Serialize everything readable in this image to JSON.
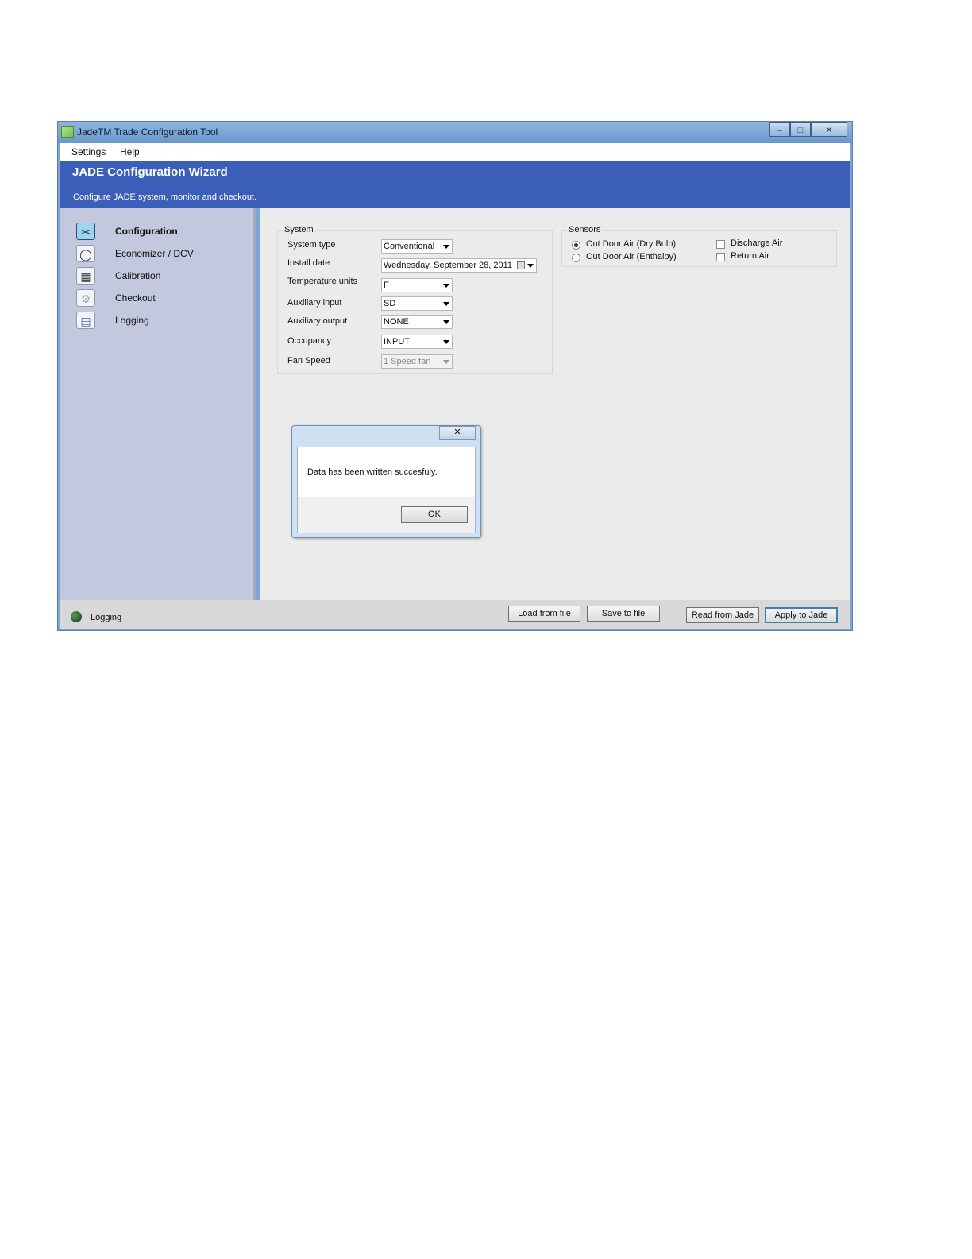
{
  "window": {
    "title": "JadeTM Trade Configuration Tool",
    "controls": {
      "minimize": "–",
      "maximize": "□",
      "close": "✕"
    }
  },
  "menu": {
    "items": [
      "Settings",
      "Help"
    ]
  },
  "header": {
    "title": "JADE Configuration Wizard",
    "subtitle": "Configure JADE system, monitor and checkout."
  },
  "sidebar": {
    "items": [
      {
        "label": "Configuration",
        "icon": "tools-icon",
        "glyph": "✂",
        "active": true
      },
      {
        "label": "Economizer / DCV",
        "icon": "economizer-icon",
        "glyph": "◯",
        "active": false
      },
      {
        "label": "Calibration",
        "icon": "calibration-icon",
        "glyph": "▦",
        "active": false
      },
      {
        "label": "Checkout",
        "icon": "gear-icon",
        "glyph": "⚙",
        "active": false
      },
      {
        "label": "Logging",
        "icon": "log-chart-icon",
        "glyph": "▤",
        "active": false
      }
    ]
  },
  "system": {
    "title": "System",
    "fields": [
      {
        "label": "System type",
        "value": "Conventional"
      },
      {
        "label": "Install date",
        "value": "Wednesday, September 28, 2011"
      },
      {
        "label": "Temperature units",
        "value": "F"
      },
      {
        "label": "Auxiliary input",
        "value": "SD"
      },
      {
        "label": "Auxiliary output",
        "value": "NONE"
      },
      {
        "label": "Occupancy",
        "value": "INPUT"
      },
      {
        "label": "Fan Speed",
        "value": "1 Speed fan",
        "disabled": true
      }
    ]
  },
  "sensors": {
    "title": "Sensors",
    "radios": [
      {
        "label": "Out Door Air (Dry Bulb)",
        "checked": true
      },
      {
        "label": "Out Door Air (Enthalpy)",
        "checked": false
      }
    ],
    "checkboxes": [
      {
        "label": "Discharge Air",
        "checked": false
      },
      {
        "label": "Return Air",
        "checked": false
      }
    ]
  },
  "dialog": {
    "close": "✕",
    "message": "Data has been written succesfuly.",
    "ok": "OK"
  },
  "footer": {
    "status": "Logging",
    "status_color": "#1a5a1e",
    "buttons": {
      "load": "Load from file",
      "save": "Save to  file",
      "read": "Read from Jade",
      "apply": "Apply to Jade"
    }
  }
}
